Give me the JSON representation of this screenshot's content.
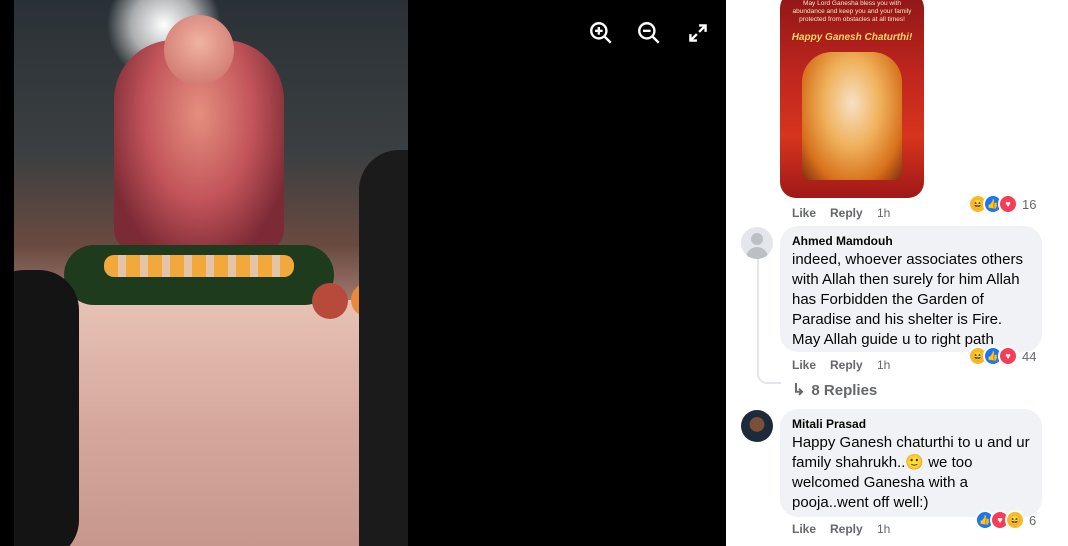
{
  "viewer": {
    "toolbar": {
      "zoom_in_icon": "zoom-in-icon",
      "zoom_out_icon": "zoom-out-icon",
      "fullscreen_icon": "fullscreen-icon"
    }
  },
  "comments": {
    "card": {
      "text": "May Lord Ganesha bless you with abundance and keep you and your family protected from obstacles at all times!",
      "title": "Happy Ganesh Chaturthi!",
      "like_label": "Like",
      "reply_label": "Reply",
      "time": "1h",
      "reaction_count": "16"
    },
    "items": [
      {
        "author": "Ahmed Mamdouh",
        "text": "indeed, whoever associates others with Allah then surely for him Allah has Forbidden the Garden of Paradise and his shelter is Fire. May Allah guide u to right path",
        "like_label": "Like",
        "reply_label": "Reply",
        "time": "1h",
        "reaction_count": "44",
        "replies_label": "8 Replies"
      },
      {
        "author": "Mitali Prasad",
        "text": "Happy Ganesh chaturthi to u and ur family shahrukh..🙂 we too welcomed Ganesha with a pooja..went off well:)",
        "like_label": "Like",
        "reply_label": "Reply",
        "time": "1h",
        "reaction_count": "6"
      }
    ]
  },
  "colors": {
    "viewer_bg": "#000000",
    "bubble_bg": "#f0f2f5",
    "meta_text": "#65676b",
    "like_blue": "#1877f2",
    "love_red": "#f33e58",
    "haha_yellow": "#f7b928"
  }
}
